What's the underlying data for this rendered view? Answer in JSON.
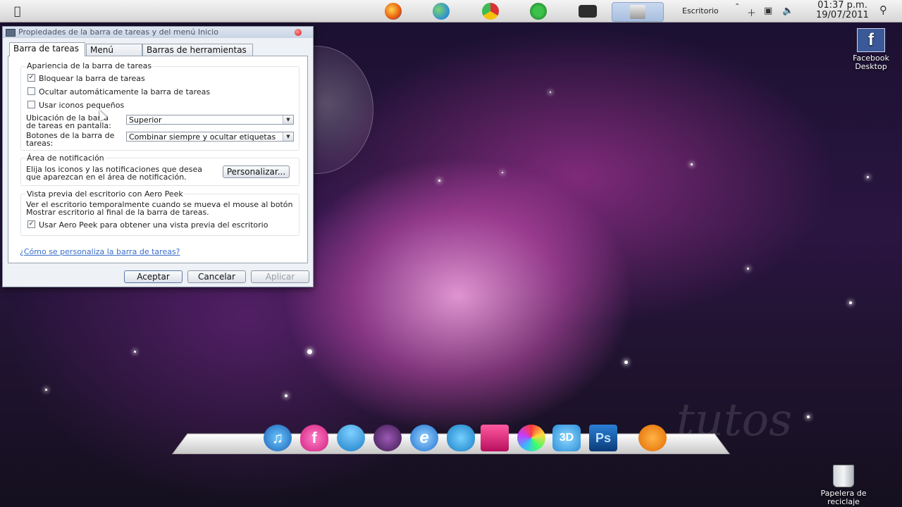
{
  "topbar": {
    "tray_label": "Escritorio",
    "clock_time": "01:37 p.m.",
    "clock_date": "19/07/2011"
  },
  "window": {
    "title": "Propiedades de la barra de tareas y del menú Inicio",
    "tabs": [
      "Barra de tareas",
      "Menú Inicio",
      "Barras de herramientas"
    ],
    "group1": {
      "label": "Apariencia de la barra de tareas",
      "checkboxes": [
        {
          "label": "Bloquear la barra de tareas",
          "checked": true
        },
        {
          "label": "Ocultar automáticamente la barra de tareas",
          "checked": false
        },
        {
          "label": "Usar iconos pequeños",
          "checked": false
        }
      ],
      "location_label": "Ubicación de la barra de tareas en pantalla:",
      "location_value": "Superior",
      "buttons_label": "Botones de la barra de tareas:",
      "buttons_value": "Combinar siempre y ocultar etiquetas"
    },
    "group2": {
      "label": "Área de notificación",
      "text": "Elija los iconos y las notificaciones que desea que aparezcan en el área de notificación.",
      "button": "Personalizar..."
    },
    "group3": {
      "label": "Vista previa del escritorio con Aero Peek",
      "text1": "Ver el escritorio temporalmente cuando se mueva el mouse al botón",
      "text2": "Mostrar escritorio al final de la barra de tareas.",
      "checkbox": {
        "label": "Usar Aero Peek para obtener una vista previa del escritorio",
        "checked": true
      }
    },
    "help_link": "¿Cómo se personaliza la barra de tareas?",
    "buttons": {
      "ok": "Aceptar",
      "cancel": "Cancelar",
      "apply": "Aplicar"
    }
  },
  "desktop_icons": {
    "facebook": "Facebook Desktop",
    "recycle_bin": "Papelera de reciclaje"
  },
  "dock_icons": [
    "itunes-icon",
    "facebook-heart-icon",
    "messenger-icon",
    "robot-icon",
    "internet-explorer-icon",
    "elephant-icon",
    "monster-icon",
    "media-disc-icon",
    "3d-icon",
    "photoshop-icon",
    "vlc-icon"
  ]
}
